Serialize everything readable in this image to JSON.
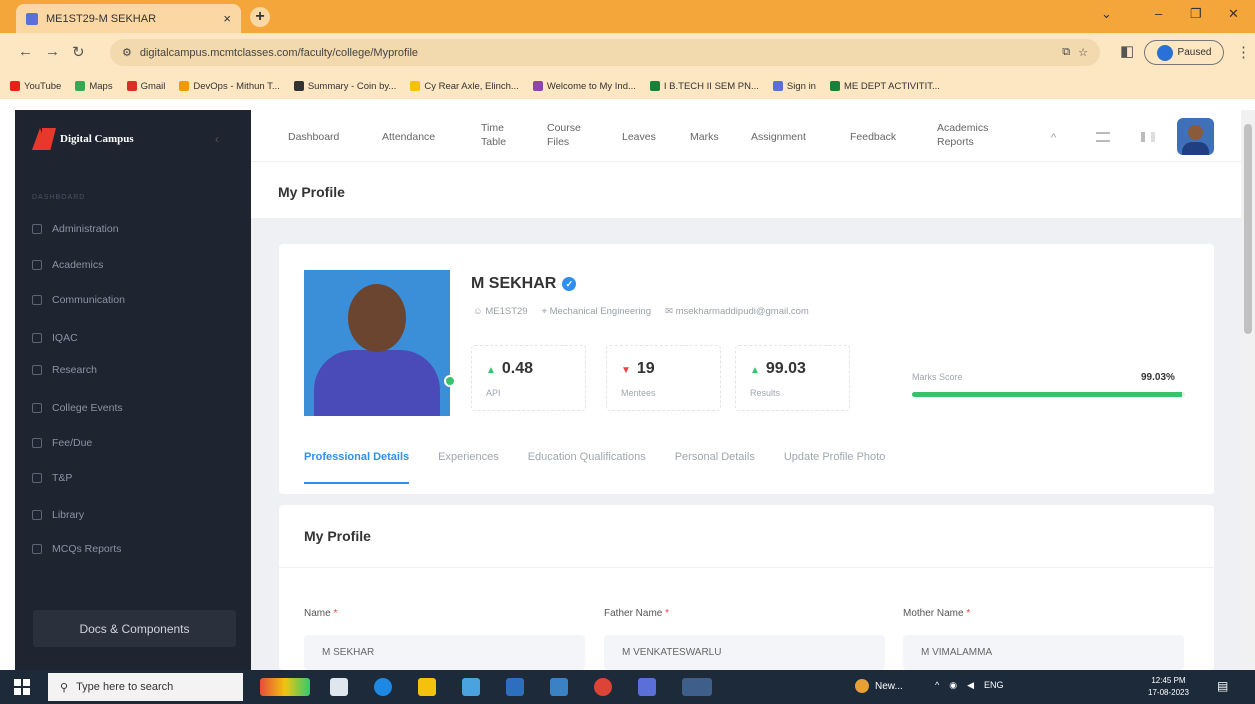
{
  "browser": {
    "tab_title": "ME1ST29-M SEKHAR",
    "tab_close": "×",
    "new_tab": "+",
    "url": "digitalcampus.mcmtclasses.com/faculty/college/Myprofile",
    "profile_btn": "Paused",
    "bookmarks": [
      {
        "label": "YouTube",
        "color": "#e62117"
      },
      {
        "label": "Maps",
        "color": "#34a853"
      },
      {
        "label": "Gmail",
        "color": "#d93025"
      },
      {
        "label": "DevOps - Mithun T...",
        "color": "#f29900"
      },
      {
        "label": "Summary - Coin by...",
        "color": "#333333"
      },
      {
        "label": "Cy Rear Axle, Elinch...",
        "color": "#f4c20d"
      },
      {
        "label": "Welcome to My Ind...",
        "color": "#8e44ad"
      },
      {
        "label": "I B.TECH II SEM PN...",
        "color": "#188038"
      },
      {
        "label": "Sign in",
        "color": "#5b6fd8"
      },
      {
        "label": "ME DEPT ACTIVITIT...",
        "color": "#188038"
      }
    ]
  },
  "sidebar": {
    "brand": "Digital Campus",
    "section_heading": "DASHBOARD",
    "items": [
      {
        "label": "Administration"
      },
      {
        "label": "Academics"
      },
      {
        "label": "Communication"
      },
      {
        "label": "IQAC"
      },
      {
        "label": "Research"
      },
      {
        "label": "College Events"
      },
      {
        "label": "Fee/Due"
      },
      {
        "label": "T&P"
      },
      {
        "label": "Library"
      },
      {
        "label": "MCQs Reports"
      }
    ],
    "docs_button": "Docs & Components"
  },
  "topnav": {
    "items": [
      {
        "label": "Dashboard"
      },
      {
        "label": "Attendance"
      },
      {
        "label": "Time Table"
      },
      {
        "label": "Course Files"
      },
      {
        "label": "Leaves"
      },
      {
        "label": "Marks"
      },
      {
        "label": "Assignment"
      },
      {
        "label": "Feedback"
      },
      {
        "label": "Academics Reports"
      }
    ]
  },
  "page": {
    "title": "My Profile"
  },
  "profile": {
    "name": "M SEKHAR",
    "id": "ME1ST29",
    "department": "Mechanical Engineering",
    "email": "msekharmaddipudi@gmail.com",
    "stats": [
      {
        "value": "0.48",
        "label": "API",
        "arrow": "▲",
        "arrow_color": "#36c36a"
      },
      {
        "value": "19",
        "label": "Mentees",
        "arrow": "▼",
        "arrow_color": "#e54343"
      },
      {
        "value": "99.03",
        "label": "Results",
        "arrow": "▲",
        "arrow_color": "#36c36a"
      }
    ],
    "score_label": "Marks Score",
    "score_value": "99.03%",
    "score_fraction": 0.9903,
    "tabs": [
      {
        "label": "Professional Details",
        "active": true
      },
      {
        "label": "Experiences",
        "active": false
      },
      {
        "label": "Education Qualifications",
        "active": false
      },
      {
        "label": "Personal Details",
        "active": false
      },
      {
        "label": "Update Profile Photo",
        "active": false
      }
    ]
  },
  "form": {
    "title": "My Profile",
    "fields": [
      {
        "label": "Name",
        "value": "M SEKHAR"
      },
      {
        "label": "Father Name",
        "value": "M VENKATESWARLU"
      },
      {
        "label": "Mother Name",
        "value": "M VIMALAMMA"
      }
    ],
    "required_mark": "*"
  },
  "taskbar": {
    "search_placeholder": "Type here to search",
    "weather": "New...",
    "lang": "ENG",
    "time": "12:45 PM",
    "date": "17-08-2023"
  }
}
